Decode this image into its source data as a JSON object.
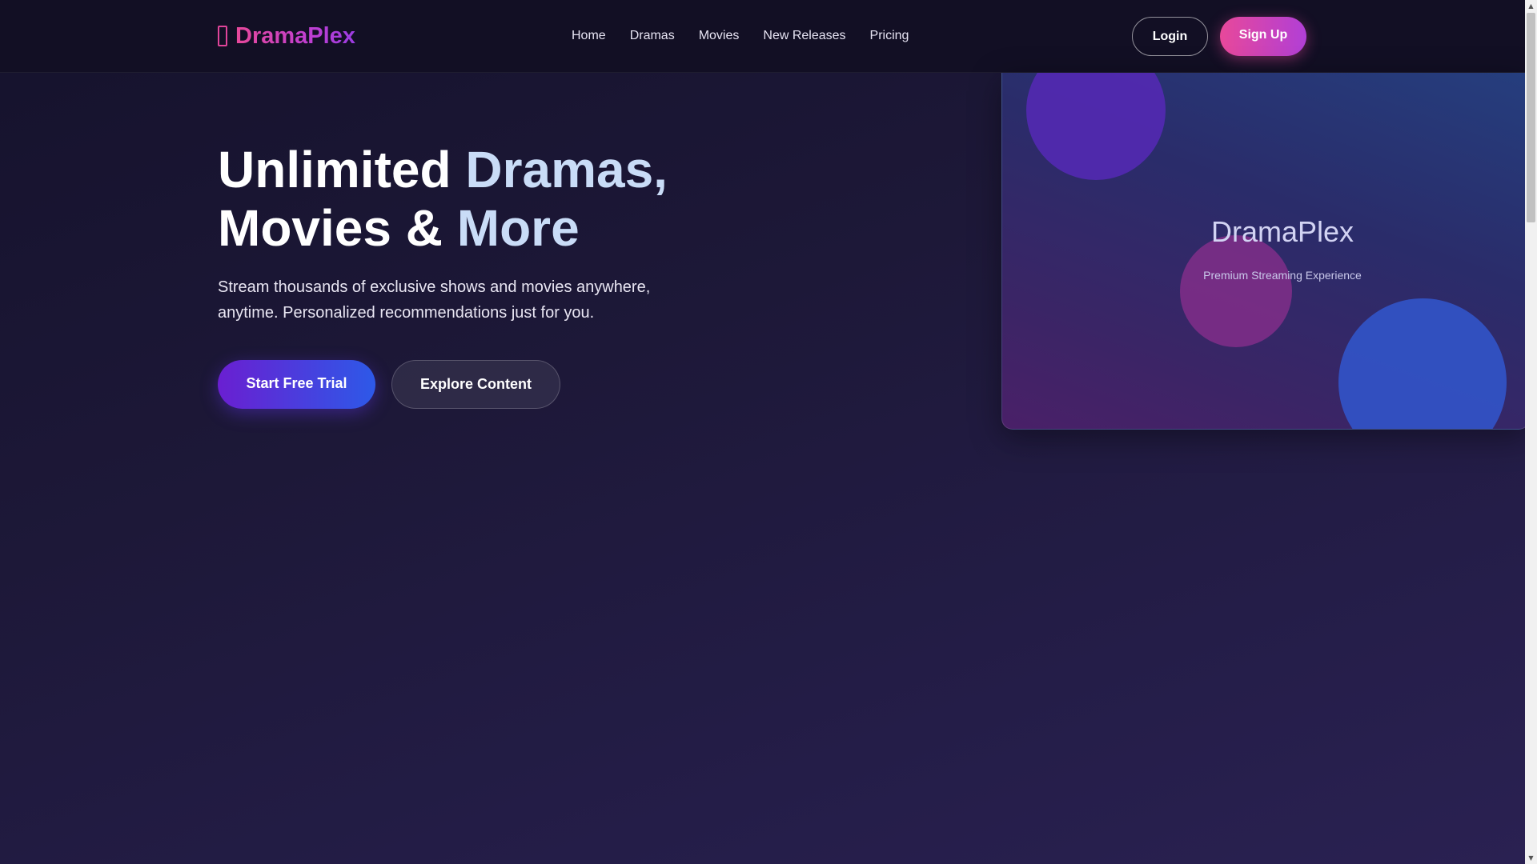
{
  "brand": {
    "name": "DramaPlex",
    "icon": "ticket-icon",
    "gradient": [
      "#e8489a",
      "#9b3ce2"
    ]
  },
  "nav": {
    "items": [
      "Home",
      "Dramas",
      "Movies",
      "New Releases",
      "Pricing"
    ]
  },
  "auth": {
    "login_label": "Login",
    "signup_label": "Sign Up"
  },
  "hero": {
    "title_part1": "Unlimited ",
    "title_highlight1": "Dramas,",
    "title_part2": "Movies & ",
    "title_highlight2": "More",
    "subtitle": "Stream thousands of exclusive shows and movies anywhere, anytime. Personalized recommendations just for you.",
    "primary_cta": "Start Free Trial",
    "secondary_cta": "Explore Content"
  },
  "showcase": {
    "title": "DramaPlex",
    "subtitle": "Premium Streaming Experience"
  },
  "colors": {
    "background": "#1d1838",
    "accent_pink": "#e8489a",
    "accent_purple": "#6a1fd1",
    "accent_blue": "#2d59e8",
    "highlight_text": "#c9dcf7"
  }
}
